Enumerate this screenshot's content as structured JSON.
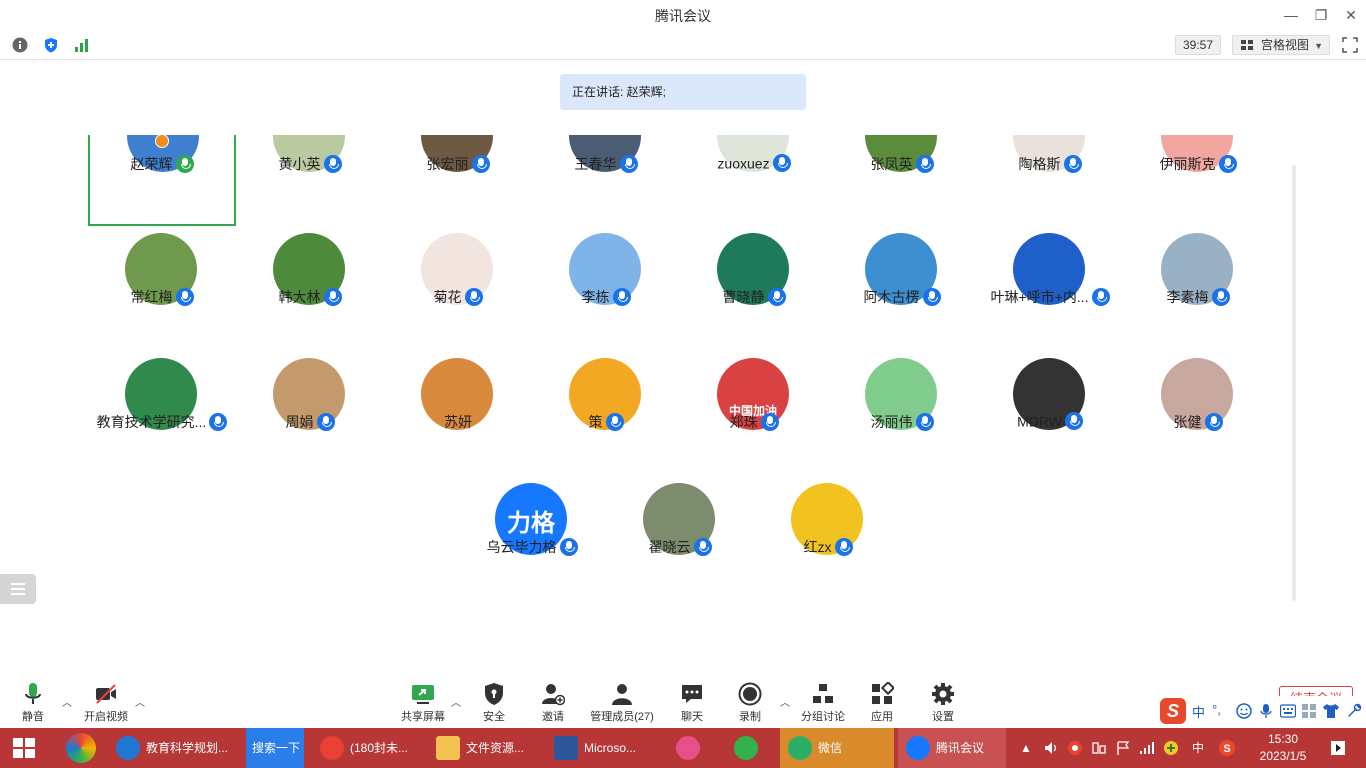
{
  "window": {
    "title": "腾讯会议",
    "controls": {
      "minimize": "—",
      "restore": "❐",
      "close": "✕"
    }
  },
  "infobar": {
    "timer": "39:57",
    "view_mode": "宫格视图",
    "icons": [
      "info-icon",
      "shield-icon",
      "signal-icon",
      "fullscreen-icon"
    ]
  },
  "speaking_banner": "正在讲话: 赵荣辉;",
  "participants": [
    {
      "name": "赵荣辉",
      "active": true,
      "avatar_color": "#3e7fd0",
      "avatar_text": ""
    },
    {
      "name": "黄小英",
      "avatar_color": "#b9c9a0",
      "avatar_text": ""
    },
    {
      "name": "张宏丽",
      "avatar_color": "#6e5a42",
      "avatar_text": ""
    },
    {
      "name": "王春华",
      "avatar_color": "#4b5d73",
      "avatar_text": ""
    },
    {
      "name": "zuoxuez",
      "avatar_color": "#dfe5d9",
      "avatar_text": ""
    },
    {
      "name": "张凤英",
      "avatar_color": "#5a8c3c",
      "avatar_text": ""
    },
    {
      "name": "陶格斯",
      "avatar_color": "#e9e2dc",
      "avatar_text": ""
    },
    {
      "name": "伊丽斯克",
      "avatar_color": "#f2a6a0",
      "avatar_text": ""
    },
    {
      "name": "常红梅",
      "avatar_color": "#6f9a4e",
      "avatar_text": ""
    },
    {
      "name": "韩大林",
      "avatar_color": "#4d8a3a",
      "avatar_text": ""
    },
    {
      "name": "菊花",
      "avatar_color": "#f2e4df",
      "avatar_text": ""
    },
    {
      "name": "李栋",
      "avatar_color": "#7fb4e8",
      "avatar_text": ""
    },
    {
      "name": "曹晓静",
      "avatar_color": "#1e7a5a",
      "avatar_text": ""
    },
    {
      "name": "阿木古楞",
      "avatar_color": "#3d8fd0",
      "avatar_text": ""
    },
    {
      "name": "叶琳+呼市+内...",
      "avatar_color": "#1f5fc9",
      "avatar_text": ""
    },
    {
      "name": "李素梅",
      "avatar_color": "#9ab0c4",
      "avatar_text": ""
    },
    {
      "name": "教育技术学研究...",
      "avatar_color": "#2f8a4c",
      "avatar_text": ""
    },
    {
      "name": "周娟",
      "avatar_color": "#c49a6c",
      "avatar_text": ""
    },
    {
      "name": "苏妍",
      "avatar_color": "#d8893c",
      "avatar_text": "",
      "no_mic": true
    },
    {
      "name": "策",
      "avatar_color": "#f3a823",
      "avatar_text": ""
    },
    {
      "name": "郑珠",
      "avatar_color": "#d94242",
      "avatar_text": "中国加油"
    },
    {
      "name": "汤丽伟",
      "avatar_color": "#7fcc8c",
      "avatar_text": ""
    },
    {
      "name": "MDRW",
      "avatar_color": "#333333",
      "avatar_text": ""
    },
    {
      "name": "张健",
      "avatar_color": "#c8a79e",
      "avatar_text": ""
    },
    {
      "name": "乌云毕力格",
      "avatar_color": "#1677ff",
      "avatar_text": "力格"
    },
    {
      "name": "翟晓云",
      "avatar_color": "#7d8c6c",
      "avatar_text": ""
    },
    {
      "name": "红zx",
      "avatar_color": "#f2c320",
      "avatar_text": ""
    }
  ],
  "toolbar": {
    "mute": "静音",
    "video": "开启视频",
    "share": "共享屏幕",
    "security": "安全",
    "invite": "邀请",
    "members": "管理成员(27)",
    "chat": "聊天",
    "record": "录制",
    "breakout": "分组讨论",
    "apps": "应用",
    "settings": "设置",
    "end": "结束会议"
  },
  "ime": {
    "logo": "S",
    "lang": "中",
    "punct": "°,",
    "items": [
      "smile-icon",
      "mic-icon",
      "keyboard-icon",
      "grid-icon",
      "shirt-icon",
      "wrench-icon"
    ]
  },
  "taskbar": {
    "apps": [
      {
        "label": "教育科学规划...",
        "color": "#1e78d2"
      },
      {
        "label": "搜索一下",
        "color": "#2b7de9"
      },
      {
        "label": "(180封未...",
        "color": "#e94235"
      },
      {
        "label": "文件资源...",
        "color": "#f2c14e"
      },
      {
        "label": "Microso...",
        "color": "#2b579a"
      },
      {
        "label": "",
        "color": "#e6508a"
      },
      {
        "label": "",
        "color": "#31b24b"
      },
      {
        "label": "微信",
        "color": "#2aae67"
      },
      {
        "label": "腾讯会议",
        "color": "#1677ff"
      }
    ],
    "tray_lang": "中",
    "time": "15:30",
    "date": "2023/1/5"
  }
}
